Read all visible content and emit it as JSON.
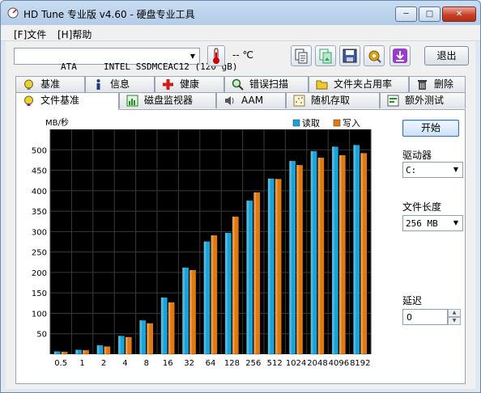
{
  "window": {
    "title": "HD Tune 专业版 v4.60 - 硬盘专业工具"
  },
  "window_controls": {
    "minimize": "─",
    "maximize": "□",
    "close": "✕"
  },
  "menu": [
    {
      "label": "[F]文件"
    },
    {
      "label": "[H]帮助"
    }
  ],
  "toolbar": {
    "drive_select": "ATA     INTEL SSDMCEAC12 (120 gB)",
    "temperature": "-- ℃",
    "exit_label": "退出",
    "icons": [
      "thermometer-icon",
      "copy-text-icon",
      "copy-screen-icon",
      "save-icon",
      "options-icon",
      "download-icon"
    ]
  },
  "tabs_row1": [
    {
      "label": "基准",
      "icon": "benchmark-icon"
    },
    {
      "label": "信息",
      "icon": "info-icon"
    },
    {
      "label": "健康",
      "icon": "health-icon"
    },
    {
      "label": "错误扫描",
      "icon": "error-scan-icon"
    },
    {
      "label": "文件夹占用率",
      "icon": "folder-usage-icon"
    },
    {
      "label": "删除",
      "icon": "erase-icon"
    }
  ],
  "tabs_row2": [
    {
      "label": "文件基准",
      "icon": "file-benchmark-icon",
      "active": true
    },
    {
      "label": "磁盘监视器",
      "icon": "disk-monitor-icon"
    },
    {
      "label": "AAM",
      "icon": "speaker-icon"
    },
    {
      "label": "随机存取",
      "icon": "random-access-icon"
    },
    {
      "label": "额外测试",
      "icon": "extra-tests-icon"
    }
  ],
  "side": {
    "start_label": "开始",
    "drive_label": "驱动器",
    "drive_value": "C:",
    "file_length_label": "文件长度",
    "file_length_value": "256 MB",
    "delay_label": "延迟",
    "delay_value": "0"
  },
  "colors": {
    "read": "#1aa3d9",
    "write": "#e07a10",
    "plot_bg": "#000000"
  },
  "chart_data": {
    "type": "bar",
    "ylabel": "MB/秒",
    "ylim": [
      0,
      550
    ],
    "yticks": [
      50,
      100,
      150,
      200,
      250,
      300,
      350,
      400,
      450,
      500
    ],
    "grid": true,
    "legend_position": "top-right",
    "categories": [
      "0.5",
      "1",
      "2",
      "4",
      "8",
      "16",
      "32",
      "64",
      "128",
      "256",
      "512",
      "1024",
      "2048",
      "4096",
      "8192"
    ],
    "series": [
      {
        "name": "读取",
        "color": "#1aa3d9",
        "values": [
          7,
          11,
          22,
          45,
          83,
          139,
          212,
          276,
          297,
          376,
          430,
          473,
          497,
          508,
          512
        ]
      },
      {
        "name": "写入",
        "color": "#e07a10",
        "values": [
          6,
          10,
          19,
          42,
          76,
          127,
          206,
          291,
          337,
          396,
          429,
          463,
          481,
          487,
          492
        ]
      }
    ]
  }
}
